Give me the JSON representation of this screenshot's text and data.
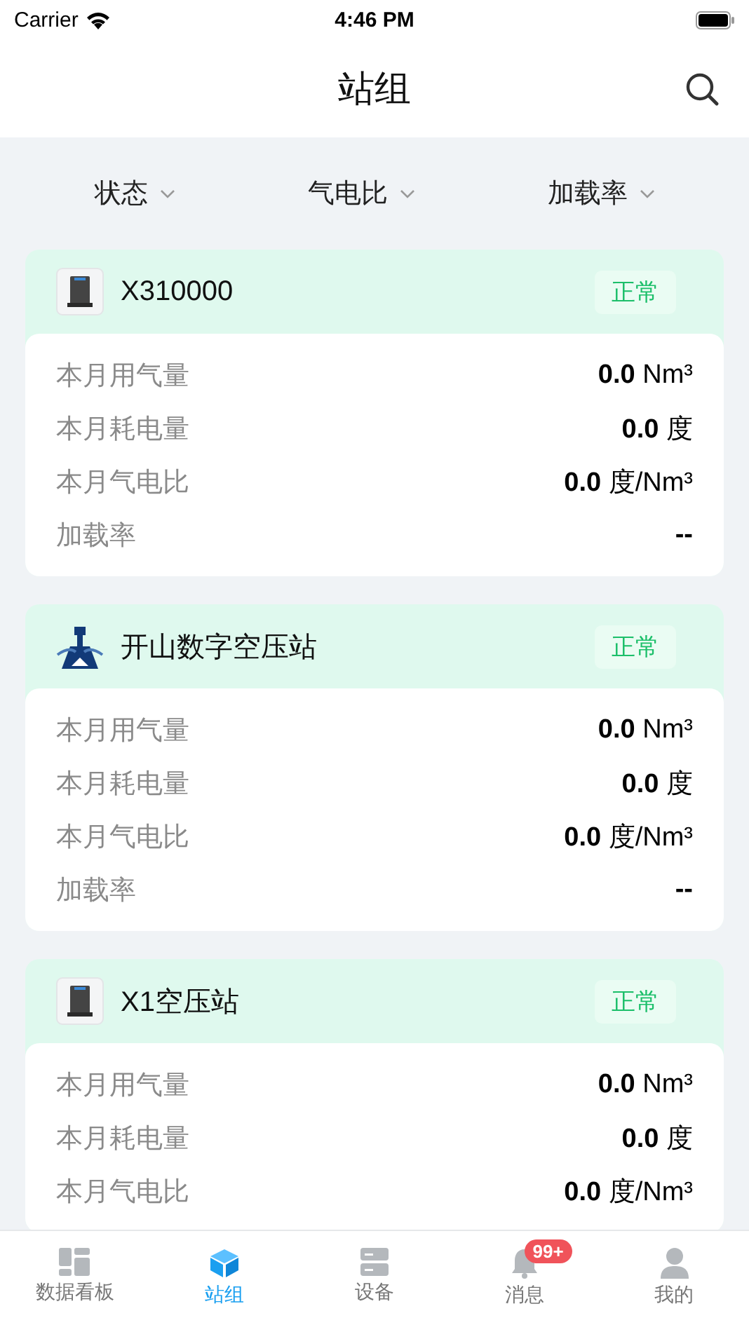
{
  "status_bar": {
    "carrier": "Carrier",
    "time": "4:46 PM"
  },
  "header": {
    "title": "站组"
  },
  "filters": [
    {
      "label": "状态"
    },
    {
      "label": "气电比"
    },
    {
      "label": "加载率"
    }
  ],
  "stations": [
    {
      "name": "X310000",
      "kind": "device",
      "status": "正常",
      "rows": [
        {
          "label": "本月用气量",
          "value": "0.0",
          "unit": "Nm³"
        },
        {
          "label": "本月耗电量",
          "value": "0.0",
          "unit": "度"
        },
        {
          "label": "本月气电比",
          "value": "0.0",
          "unit": "度/Nm³"
        },
        {
          "label": "加载率",
          "value": "--"
        }
      ]
    },
    {
      "name": "开山数字空压站",
      "kind": "logo",
      "status": "正常",
      "rows": [
        {
          "label": "本月用气量",
          "value": "0.0",
          "unit": "Nm³"
        },
        {
          "label": "本月耗电量",
          "value": "0.0",
          "unit": "度"
        },
        {
          "label": "本月气电比",
          "value": "0.0",
          "unit": "度/Nm³"
        },
        {
          "label": "加载率",
          "value": "--"
        }
      ]
    },
    {
      "name": "X1空压站",
      "kind": "device",
      "status": "正常",
      "rows": [
        {
          "label": "本月用气量",
          "value": "0.0",
          "unit": "Nm³"
        },
        {
          "label": "本月耗电量",
          "value": "0.0",
          "unit": "度"
        },
        {
          "label": "本月气电比",
          "value": "0.0",
          "unit": "度/Nm³"
        }
      ]
    }
  ],
  "tab_bar": [
    {
      "label": "数据看板",
      "selected": false
    },
    {
      "label": "站组",
      "selected": true
    },
    {
      "label": "设备",
      "selected": false
    },
    {
      "label": "消息",
      "selected": false,
      "badge": "99+"
    },
    {
      "label": "我的",
      "selected": false
    }
  ]
}
